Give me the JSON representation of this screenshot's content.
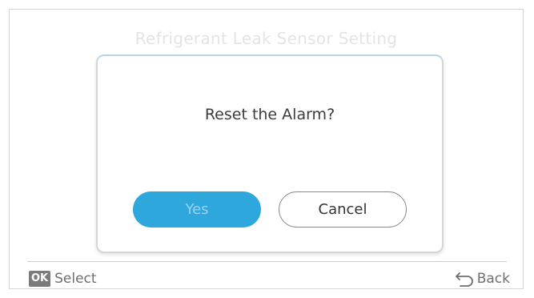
{
  "screen": {
    "title": "Refrigerant Leak Sensor Setting"
  },
  "dialog": {
    "message": "Reset the Alarm?",
    "yes_label": "Yes",
    "cancel_label": "Cancel"
  },
  "footer": {
    "ok_key_label": "OK",
    "select_label": "Select",
    "back_label": "Back"
  },
  "colors": {
    "accent": "#2ea7dd",
    "yes_text": "#9ad2ef"
  },
  "icons": {
    "back": "back-arrow-icon"
  }
}
